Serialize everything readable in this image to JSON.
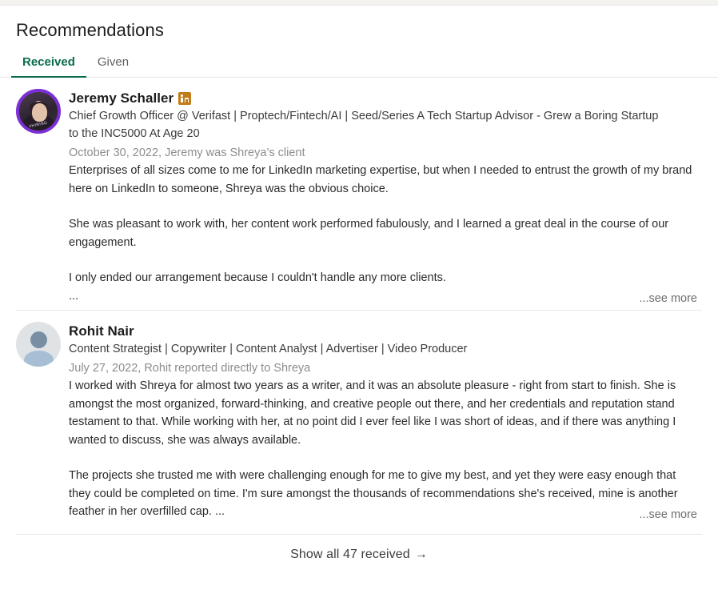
{
  "header": {
    "title": "Recommendations"
  },
  "tabs": [
    {
      "label": "Received",
      "active": true
    },
    {
      "label": "Given",
      "active": false
    }
  ],
  "recommendations": [
    {
      "name": "Jeremy Schaller",
      "badge": "linkedin-premium-badge",
      "headline": "Chief Growth Officer @ Verifast | Proptech/Fintech/AI | Seed/Series A Tech Startup Advisor - Grew a Boring Startup to the INC5000 At Age 20",
      "date_relation": "October 30, 2022, Jeremy was Shreya’s client",
      "avatar_type": "photo",
      "avatar_ring_text": "#HIRING",
      "paragraphs": [
        "Enterprises of all sizes come to me for LinkedIn marketing expertise, but when I needed to entrust the growth of my brand here on LinkedIn to someone, Shreya was the obvious choice.",
        "She was pleasant to work with, her content work performed fabulously, and I learned a great deal in the course of our engagement.",
        "I only ended our arrangement because I couldn't handle any more clients."
      ],
      "truncation_marker": "...",
      "see_more_label": "...see more"
    },
    {
      "name": "Rohit Nair",
      "badge": null,
      "headline": "Content Strategist | Copywriter | Content Analyst | Advertiser | Video Producer",
      "date_relation": "July 27, 2022, Rohit reported directly to Shreya",
      "avatar_type": "placeholder",
      "avatar_ring_text": "",
      "paragraphs": [
        "I worked with Shreya for almost two years as a writer, and it was an absolute pleasure - right from start to finish. She is amongst the most organized, forward-thinking, and creative people out there, and her credentials and reputation stand testament to that. While working with her, at no point did I ever feel like I was short of ideas, and if there was anything I wanted to discuss, she was always available.",
        "The projects she trusted me with were challenging enough for me to give my best, and yet they were easy enough that they could be completed on time. I'm sure amongst the thousands of recommendations she's received, mine is another feather in her overfilled cap. ..."
      ],
      "truncation_marker": "",
      "see_more_label": "...see more"
    }
  ],
  "footer": {
    "show_all_label": "Show all 47 received",
    "arrow_glyph": "→"
  },
  "colors": {
    "accent_green": "#0a6b4a",
    "badge_gold": "#c37d16",
    "text_primary": "#2b2b2b",
    "text_muted": "#8d8d8d"
  }
}
